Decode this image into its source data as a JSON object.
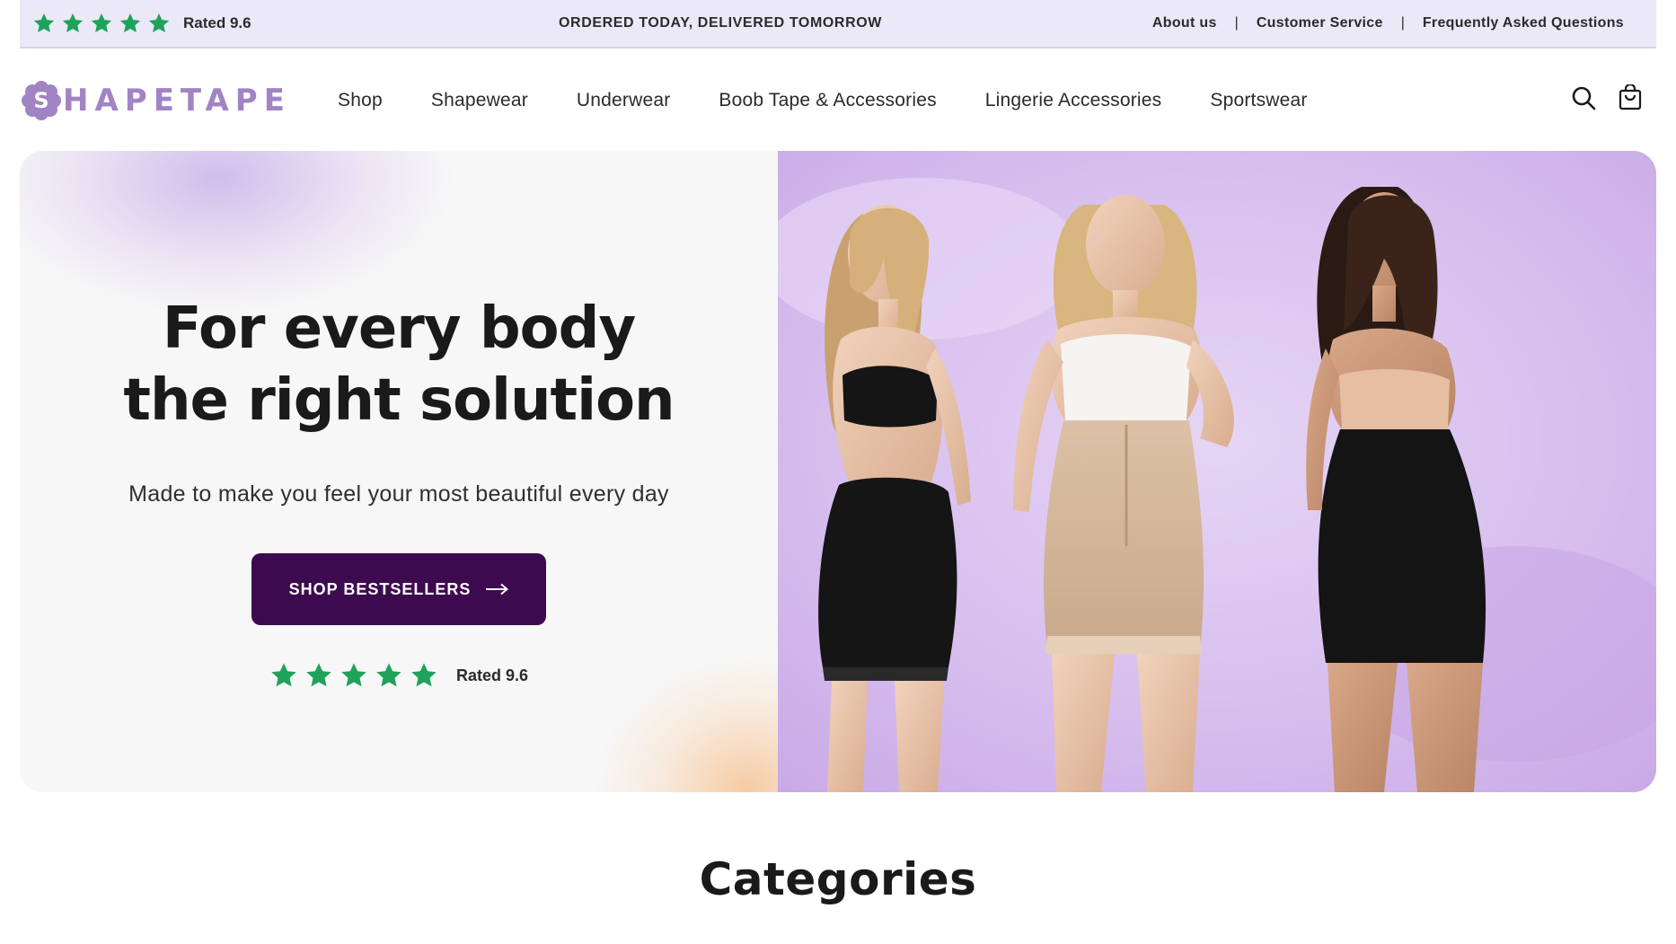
{
  "announcement": {
    "rating_text": "Rated 9.6",
    "star_count": 5,
    "star_color": "#1fa35a",
    "promo": "ORDERED TODAY, DELIVERED TOMORROW",
    "links": [
      "About us",
      "Customer Service",
      "Frequently Asked Questions"
    ],
    "separator": "|"
  },
  "header": {
    "logo_initial": "S",
    "logo_text": "HAPETAPE",
    "brand_color": "#a184c4",
    "nav": [
      "Shop",
      "Shapewear",
      "Underwear",
      "Boob Tape & Accessories",
      "Lingerie Accessories",
      "Sportswear"
    ],
    "icons": [
      "search-icon",
      "cart-icon"
    ]
  },
  "hero": {
    "title_line1": "For every body",
    "title_line2": "the right solution",
    "subtitle": "Made to make you feel your most beautiful every day",
    "cta_label": "SHOP BESTSELLERS",
    "cta_icon": "arrow-right-icon",
    "cta_color": "#3e0a4f",
    "rating_text": "Rated 9.6",
    "star_count": 5,
    "image_background": "#d9c3ef"
  },
  "categories": {
    "title": "Categories"
  }
}
